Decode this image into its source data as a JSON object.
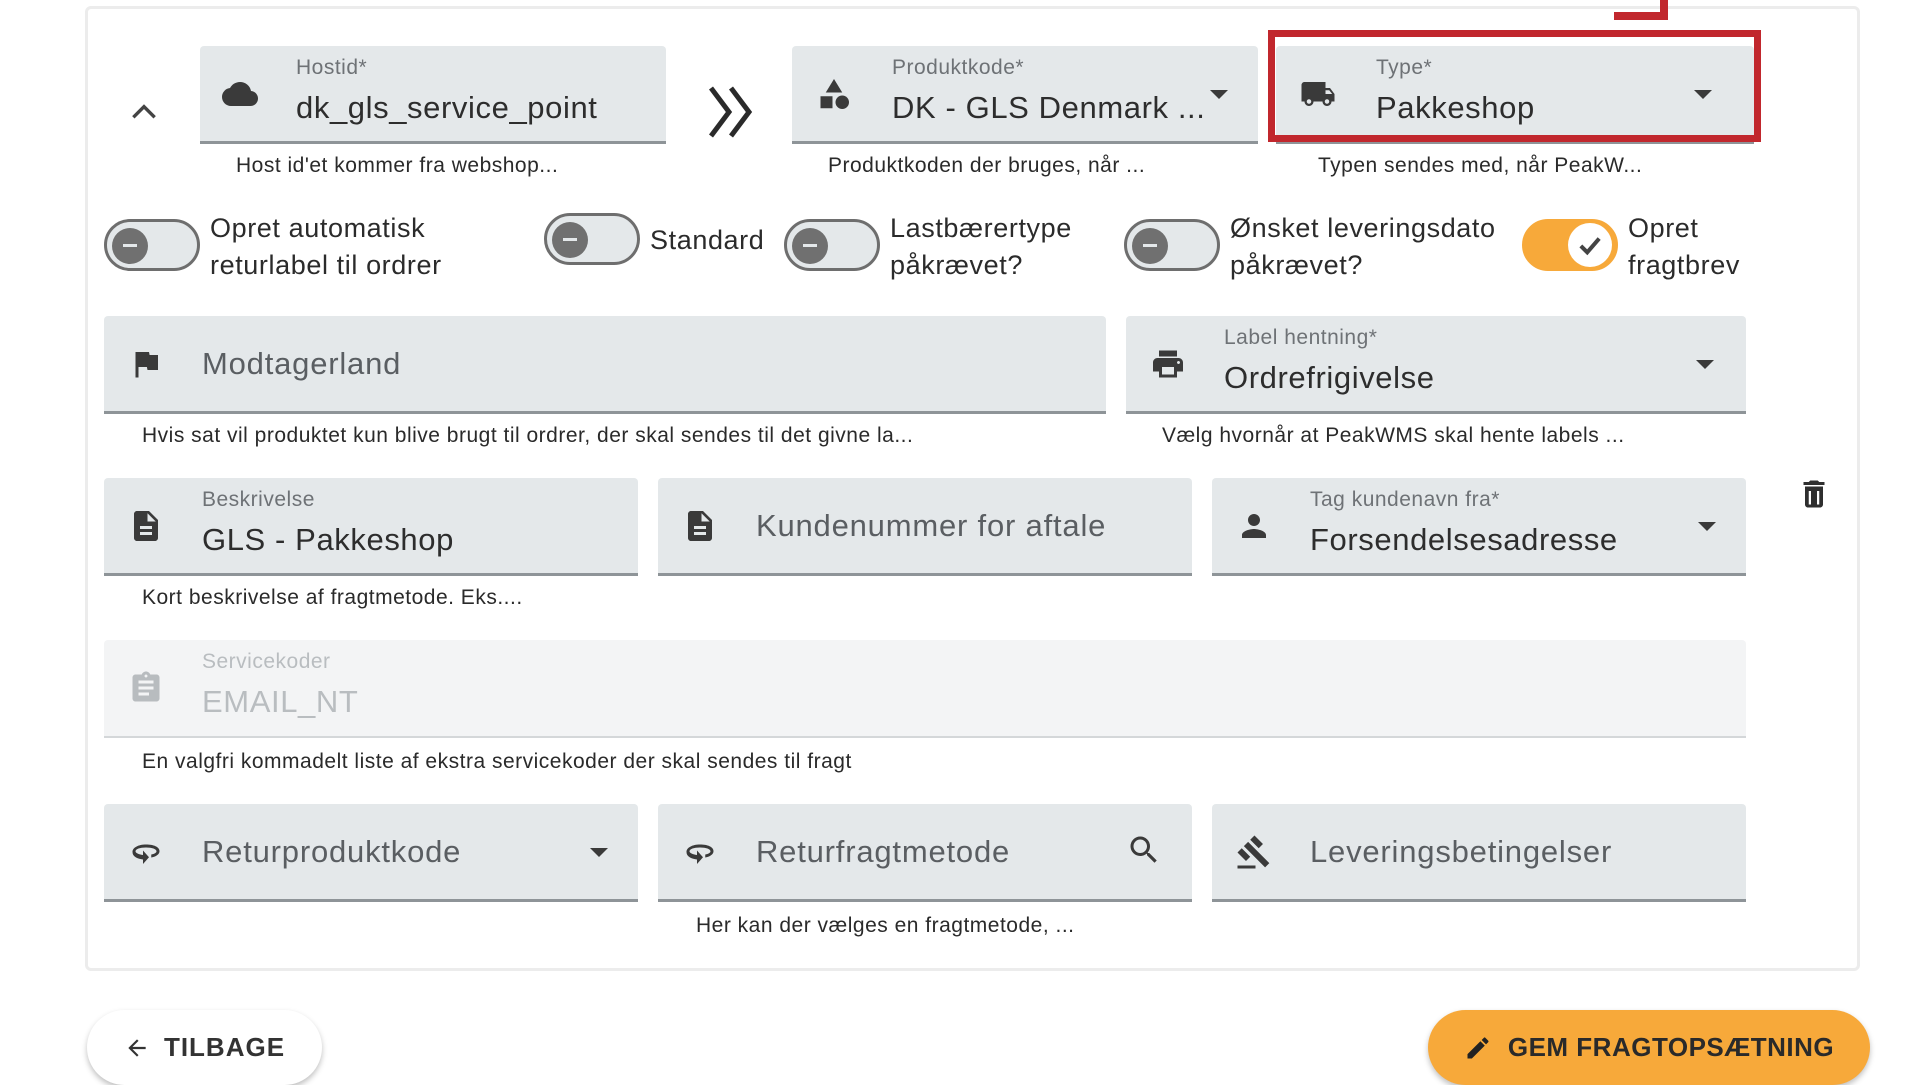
{
  "row1": {
    "host": {
      "label": "Hostid*",
      "value": "dk_gls_service_point",
      "hint": "Host id'et kommer fra webshop...",
      "icon": "cloud-icon"
    },
    "product": {
      "label": "Produktkode*",
      "value": "DK - GLS Denmark ...",
      "hint": "Produktkoden der bruges, når ...",
      "icon": "shapes-icon"
    },
    "type": {
      "label": "Type*",
      "value": "Pakkeshop",
      "hint": "Typen sendes med, når PeakW...",
      "icon": "truck-icon"
    }
  },
  "toggles": [
    {
      "label": "Opret automatisk returlabel til ordrer",
      "on": false
    },
    {
      "label": "Standard",
      "on": false
    },
    {
      "label": "Lastbærertype påkrævet?",
      "on": false
    },
    {
      "label": "Ønsket leveringsdato påkrævet?",
      "on": false
    },
    {
      "label": "Opret fragtbrev",
      "on": true
    }
  ],
  "row3": {
    "country": {
      "placeholder": "Modtagerland",
      "hint": "Hvis sat vil produktet kun blive brugt til ordrer, der skal sendes til det givne la...",
      "icon": "flag-icon"
    },
    "label_fetch": {
      "label": "Label hentning*",
      "value": "Ordrefrigivelse",
      "hint": "Vælg hvornår at PeakWMS skal hente labels ...",
      "icon": "printer-icon"
    }
  },
  "row4": {
    "description": {
      "label": "Beskrivelse",
      "value": "GLS - Pakkeshop",
      "hint": "Kort beskrivelse af fragtmetode. Eks....",
      "icon": "document-icon"
    },
    "customer_number": {
      "placeholder": "Kundenummer for aftale",
      "icon": "document-icon"
    },
    "customer_name": {
      "label": "Tag kundenavn fra*",
      "value": "Forsendelsesadresse",
      "icon": "person-icon"
    }
  },
  "service_codes": {
    "label": "Servicekoder",
    "value": "EMAIL_NT",
    "hint": "En valgfri kommadelt liste af ekstra servicekoder der skal sendes til fragt",
    "icon": "clipboard-icon"
  },
  "row6": {
    "return_product": {
      "placeholder": "Returproduktkode",
      "icon": "return-icon"
    },
    "return_shipping": {
      "placeholder": "Returfragtmetode",
      "hint": "Her kan der vælges en fragtmetode, ...",
      "icon": "return-icon"
    },
    "delivery_terms": {
      "placeholder": "Leveringsbetingelser",
      "icon": "gavel-icon"
    }
  },
  "buttons": {
    "back": "TILBAGE",
    "save": "GEM FRAGTOPSÆTNING"
  },
  "colors": {
    "accent": "#f7a93a",
    "highlight": "#c1272d",
    "field_bg": "#e4e8ea"
  }
}
